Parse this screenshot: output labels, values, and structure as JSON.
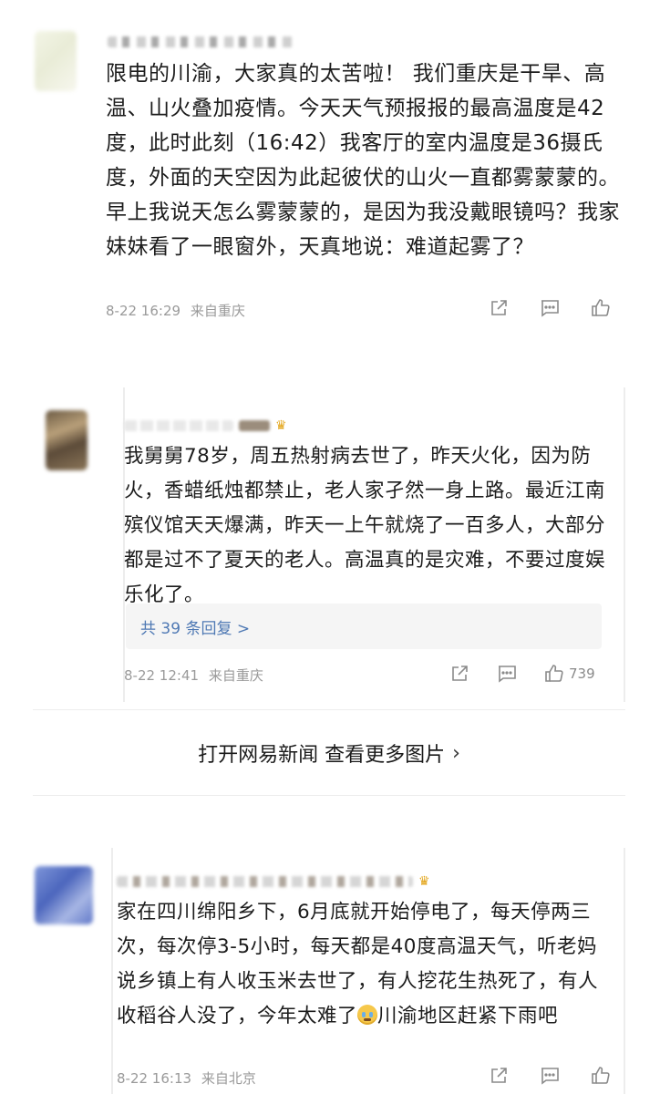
{
  "comments": [
    {
      "text": "限电的川渝，大家真的太苦啦！ 我们重庆是干旱、高温、山火叠加疫情。今天天气预报报的最高温度是42度，此时此刻（16:42）我客厅的室内温度是36摄氏度，外面的天空因为此起彼伏的山火一直都雾蒙蒙的。早上我说天怎么雾蒙蒙的，是因为我没戴眼镜吗？我家妹妹看了一眼窗外，天真地说：难道起雾了？",
      "time": "8-22 16:29",
      "location": "来自重庆"
    },
    {
      "text": "我舅舅78岁，周五热射病去世了，昨天火化，因为防火，香蜡纸烛都禁止，老人家孑然一身上路。最近江南殡仪馆天天爆满，昨天一上午就烧了一百多人，大部分都是过不了夏天的老人。高温真的是灾难，不要过度娱乐化了。",
      "reply_summary": "共 39 条回复 >",
      "time": "8-22 12:41",
      "location": "来自重庆",
      "likes": "739"
    },
    {
      "text_before": "家在四川绵阳乡下，6月底就开始停电了，每天停两三次，每次停3-5小时，每天都是40度高温天气，听老妈说乡镇上有人收玉米去世了，有人挖花生热死了，有人收稻谷人没了，今年太难了",
      "text_after": "川渝地区赶紧下雨吧",
      "time": "8-22 16:13",
      "location": "来自北京"
    }
  ],
  "open_app_banner": "打开网易新闻 查看更多图片",
  "icons": {
    "share": "share-icon",
    "comment": "comment-icon",
    "like": "thumbs-up-icon",
    "crown": "crown-icon",
    "cry_emoji": "crying-emoji-icon"
  },
  "colors": {
    "link": "#4f79b4",
    "meta": "#9a9a9a",
    "reply_bg": "#f5f5f5"
  }
}
